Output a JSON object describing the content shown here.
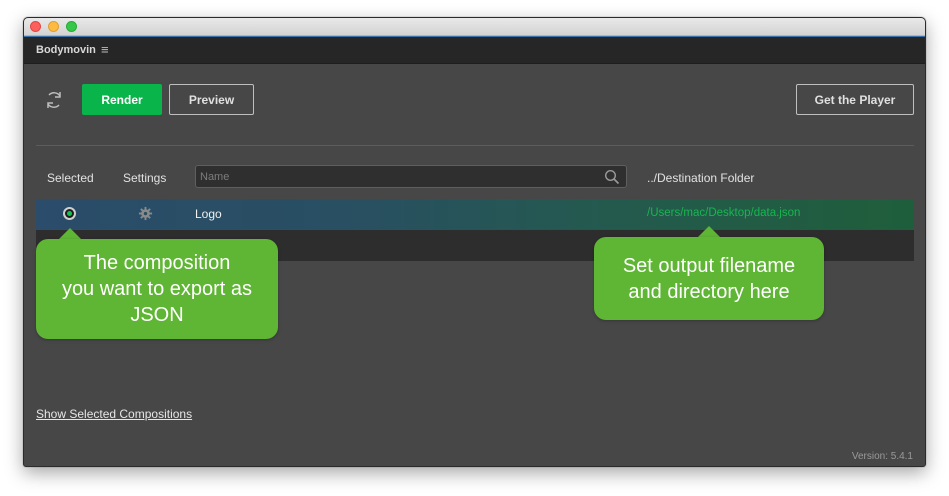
{
  "panel": {
    "title": "Bodymovin",
    "menu_icon": "menu-icon"
  },
  "toolbar": {
    "refresh_icon": "refresh-icon",
    "render_label": "Render",
    "preview_label": "Preview",
    "get_player_label": "Get the Player"
  },
  "columns": {
    "selected": "Selected",
    "settings": "Settings",
    "destination": "../Destination Folder"
  },
  "search": {
    "placeholder": "Name",
    "value": "",
    "icon": "search-icon"
  },
  "compositions": [
    {
      "selected": true,
      "settings_icon": "gear-icon",
      "name": "Logo",
      "destination": "/Users/mac/Desktop/data.json"
    }
  ],
  "footer": {
    "show_selected_label": "Show Selected Compositions",
    "version": "Version: 5.4.1"
  },
  "callouts": {
    "left": "The composition\nyou want to export as\nJSON",
    "right": "Set output filename\nand directory here"
  },
  "colors": {
    "accent_green": "#09b54a",
    "destination_text": "#17b650",
    "callout_bg": "#5fb534",
    "panel_bg": "#474747"
  }
}
